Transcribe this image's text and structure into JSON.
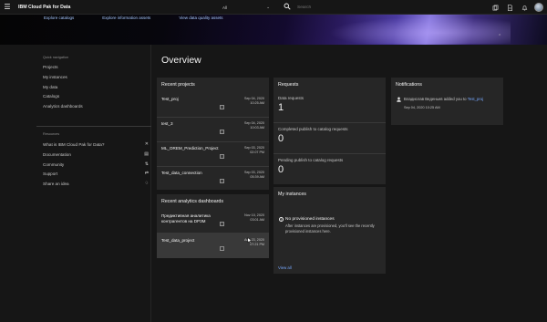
{
  "header": {
    "brand": "IBM Cloud Pak for Data",
    "scope": "All",
    "search_placeholder": "Search",
    "icons": [
      "menu-icon",
      "chevron-down-icon",
      "search-icon",
      "catalog-icon",
      "document-icon",
      "notification-icon",
      "user-avatar"
    ]
  },
  "banner": {
    "links": [
      "Explore catalogs",
      "Explore information assets",
      "View data quality assets"
    ]
  },
  "quick_nav": {
    "title": "Quick navigation",
    "items": [
      "Projects",
      "My instances",
      "My data",
      "Catalogs",
      "Analytics dashboards"
    ]
  },
  "resources": {
    "title": "Resources",
    "items": [
      {
        "label": "What is IBM Cloud Pak for Data?",
        "icon": "tools-icon"
      },
      {
        "label": "Documentation",
        "icon": "document-icon"
      },
      {
        "label": "Community",
        "icon": "community-icon"
      },
      {
        "label": "Support",
        "icon": "support-icon"
      },
      {
        "label": "Share an idea",
        "icon": "lightbulb-icon"
      }
    ]
  },
  "page_title": "Overview",
  "recent_projects": {
    "title": "Recent projects",
    "items": [
      {
        "name": "Test_proj",
        "date": "Sep 04, 2020 10:25 AM"
      },
      {
        "name": "test_3",
        "date": "Sep 04, 2020 10:03 AM"
      },
      {
        "name": "ML_OREM_Prediction_Project",
        "date": "Sep 03, 2020 02:07 PM"
      },
      {
        "name": "Test_data_connection",
        "date": "Sep 03, 2020 05:39 AM"
      }
    ]
  },
  "recent_dashboards": {
    "title": "Recent analytics dashboards",
    "items": [
      {
        "name": "Предиктивная аналитика контрагентов на DP3M",
        "date": "Nov 10, 2020 03:01 AM"
      },
      {
        "name": "Test_data_project",
        "date": "Aug 23, 2020 07:21 PM"
      }
    ]
  },
  "requests": {
    "title": "Requests",
    "items": [
      {
        "label": "Data requests",
        "value": "1"
      },
      {
        "label": "Completed publish to catalog requests",
        "value": "0"
      },
      {
        "label": "Pending publish to catalog requests",
        "value": "0"
      }
    ]
  },
  "my_instances": {
    "title": "My instances",
    "message": "No provisioned instances",
    "sub": "After instances are provisioned, you'll see the recently provisioned instances here.",
    "view_all": "View all"
  },
  "notifications": {
    "title": "Notifications",
    "text_prefix": "Владислав Веденьев added you to ",
    "link": "Test_proj",
    "time": "Sep 04, 2020 10:25 AM"
  },
  "colors": {
    "background": "#161616",
    "card": "#262626",
    "link": "#78a9ff",
    "text": "#f4f4f4"
  }
}
